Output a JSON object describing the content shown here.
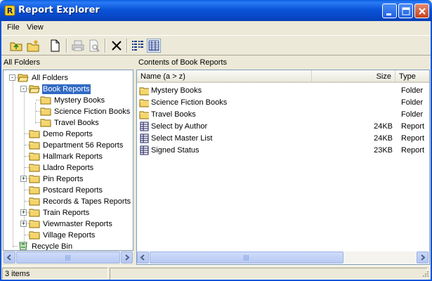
{
  "window": {
    "title": "Report Explorer",
    "app_icon_letter": "R"
  },
  "menu": {
    "items": [
      {
        "label": "File"
      },
      {
        "label": "View"
      }
    ]
  },
  "toolbar": {
    "tools": [
      "up-folder-icon",
      "new-folder-icon",
      "new-report-icon",
      "print-icon",
      "print-preview-icon",
      "delete-icon",
      "list-view-icon",
      "details-view-icon"
    ],
    "active": "details-view-icon"
  },
  "left_pane": {
    "header": "All Folders",
    "tree": [
      {
        "label": "All Folders",
        "level": 0,
        "expander": "-",
        "icon": "open-folder-icon"
      },
      {
        "label": "Book Reports",
        "level": 1,
        "expander": "-",
        "icon": "open-folder-icon",
        "selected": true
      },
      {
        "label": "Mystery Books",
        "level": 2,
        "expander": "",
        "icon": "folder-icon"
      },
      {
        "label": "Science Fiction Books",
        "level": 2,
        "expander": "",
        "icon": "folder-icon"
      },
      {
        "label": "Travel Books",
        "level": 2,
        "expander": "",
        "icon": "folder-icon"
      },
      {
        "label": "Demo Reports",
        "level": 1,
        "expander": "",
        "icon": "folder-icon"
      },
      {
        "label": "Department 56 Reports",
        "level": 1,
        "expander": "",
        "icon": "folder-icon"
      },
      {
        "label": "Hallmark Reports",
        "level": 1,
        "expander": "",
        "icon": "folder-icon"
      },
      {
        "label": "Lladro Reports",
        "level": 1,
        "expander": "",
        "icon": "folder-icon"
      },
      {
        "label": "Pin Reports",
        "level": 1,
        "expander": "+",
        "icon": "folder-icon"
      },
      {
        "label": "Postcard Reports",
        "level": 1,
        "expander": "",
        "icon": "folder-icon"
      },
      {
        "label": "Records & Tapes Reports",
        "level": 1,
        "expander": "",
        "icon": "folder-icon"
      },
      {
        "label": "Train Reports",
        "level": 1,
        "expander": "+",
        "icon": "folder-icon"
      },
      {
        "label": "Viewmaster Reports",
        "level": 1,
        "expander": "+",
        "icon": "folder-icon"
      },
      {
        "label": "Village Reports",
        "level": 1,
        "expander": "",
        "icon": "folder-icon"
      },
      {
        "label": "Recycle Bin",
        "level": 0,
        "expander": "",
        "icon": "recycle-bin-icon"
      }
    ]
  },
  "right_pane": {
    "header": "Contents of Book Reports",
    "columns": {
      "name": "Name (a > z)",
      "size": "Size",
      "type": "Type"
    },
    "rows": [
      {
        "name": "Mystery Books",
        "size": "",
        "type": "Folder",
        "icon": "folder-icon"
      },
      {
        "name": "Science Fiction Books",
        "size": "",
        "type": "Folder",
        "icon": "folder-icon"
      },
      {
        "name": "Travel Books",
        "size": "",
        "type": "Folder",
        "icon": "folder-icon"
      },
      {
        "name": "Select by Author",
        "size": "24KB",
        "type": "Report",
        "icon": "report-icon"
      },
      {
        "name": "Select Master List",
        "size": "24KB",
        "type": "Report",
        "icon": "report-icon"
      },
      {
        "name": "Signed Status",
        "size": "23KB",
        "type": "Report",
        "icon": "report-icon"
      }
    ]
  },
  "status": {
    "items_text": "3 items"
  },
  "colors": {
    "titlebar": "#0a54d8",
    "selection": "#316ac5",
    "folder": "#f5d56b"
  }
}
